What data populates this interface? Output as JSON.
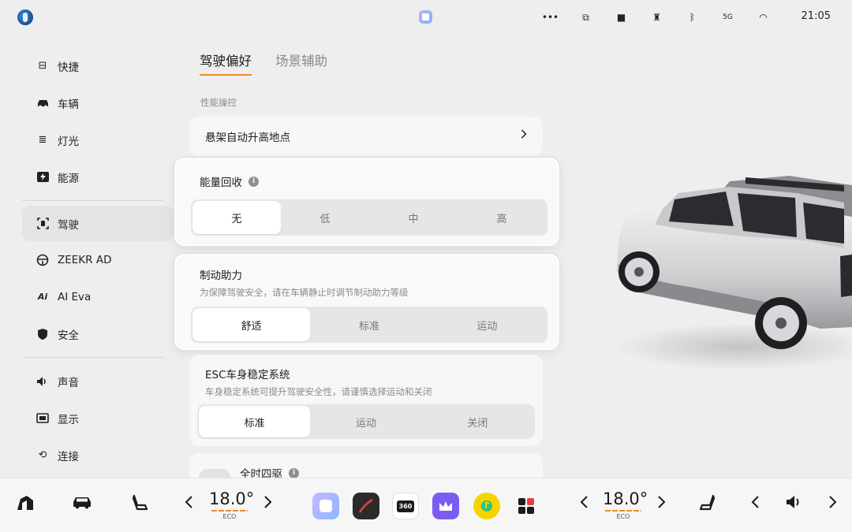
{
  "statusbar": {
    "icons": [
      "more-dots-icon",
      "screen-mirror-icon",
      "camera-icon",
      "tower-icon",
      "bluetooth-icon",
      "signal-5g-icon",
      "wifi-icon"
    ],
    "icon_glyphs": [
      "•••",
      "⧉",
      "■",
      "♜",
      "ᛒ",
      "5G",
      "◠"
    ],
    "time": "21:05"
  },
  "sidebar": {
    "items": [
      {
        "label": "快捷",
        "icon": "toggle-icon",
        "glyph": "⊟"
      },
      {
        "label": "车辆",
        "icon": "car-icon",
        "glyph": "🚘"
      },
      {
        "label": "灯光",
        "icon": "headlight-icon",
        "glyph": "≣"
      },
      {
        "label": "能源",
        "icon": "energy-icon",
        "glyph": "⚡"
      },
      {
        "label": "驾驶",
        "icon": "driving-icon",
        "glyph": "⌗"
      },
      {
        "label": "ZEEKR AD",
        "icon": "steering-wheel-icon",
        "glyph": "◎"
      },
      {
        "label": "AI Eva",
        "icon": "ai-icon",
        "glyph": "Ai"
      },
      {
        "label": "安全",
        "icon": "shield-icon",
        "glyph": "⛊"
      },
      {
        "label": "声音",
        "icon": "speaker-icon",
        "glyph": "🔈"
      },
      {
        "label": "显示",
        "icon": "display-icon",
        "glyph": "▣"
      },
      {
        "label": "连接",
        "icon": "link-icon",
        "glyph": "⟲"
      }
    ],
    "active_index": 4
  },
  "tabs": [
    {
      "label": "驾驶偏好",
      "active": true
    },
    {
      "label": "场景辅助",
      "active": false
    }
  ],
  "section_label": "性能操控",
  "suspension": {
    "label": "悬架自动升高地点"
  },
  "energy_recovery": {
    "title": "能量回收",
    "options": [
      "无",
      "低",
      "中",
      "高"
    ],
    "selected": "无"
  },
  "brake_assist": {
    "title": "制动助力",
    "subtitle": "为保障驾驶安全，请在车辆静止时调节制动助力等级",
    "options": [
      "舒适",
      "标准",
      "运动"
    ],
    "selected": "舒适"
  },
  "esc": {
    "title": "ESC车身稳定系统",
    "subtitle": "车身稳定系统可提升驾驶安全性，请谨慎选择运动和关闭",
    "options": [
      "标准",
      "运动",
      "关闭"
    ],
    "selected": "标准"
  },
  "awd": {
    "title": "全时四驱"
  },
  "dock": {
    "left_temp": {
      "value": "18.0°",
      "mode": "ECO"
    },
    "right_temp": {
      "value": "18.0°",
      "mode": "ECO"
    },
    "apps": [
      {
        "name": "launcher-app-icon",
        "color": "#a6a2f7"
      },
      {
        "name": "navigation-app-icon",
        "color": "#2b2b2b"
      },
      {
        "name": "camera-360-app-icon",
        "color": "#1c1c1e",
        "text": "360"
      },
      {
        "name": "crown-app-icon",
        "color": "#7b5cf0"
      },
      {
        "name": "music-app-icon",
        "color": "#f5d400"
      },
      {
        "name": "apps-grid-icon",
        "color": "#ffffff"
      }
    ]
  },
  "colors": {
    "accent": "#f08a24",
    "background": "#eeeeef",
    "card": "#f7f7f8"
  }
}
